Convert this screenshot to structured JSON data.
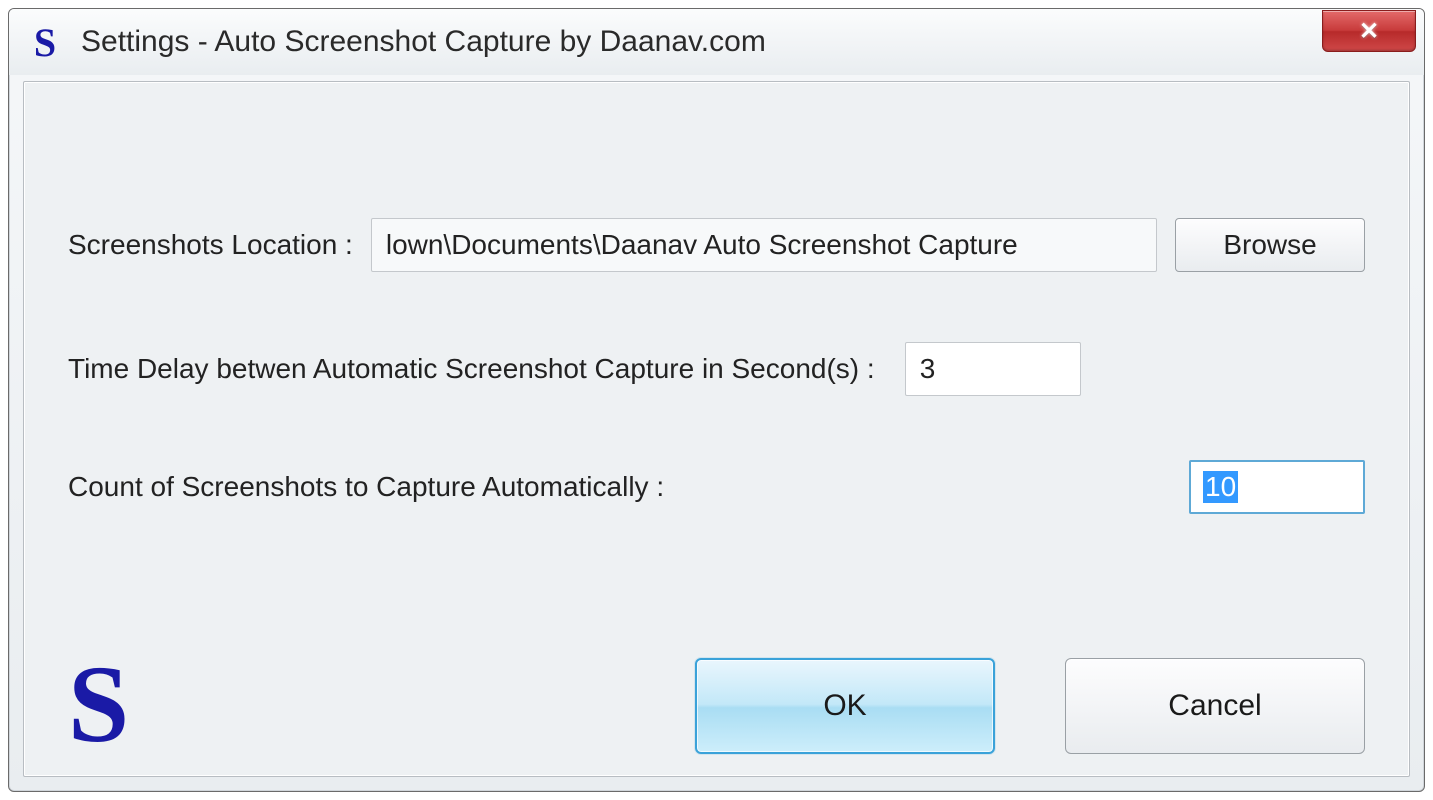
{
  "window": {
    "title": "Settings - Auto Screenshot Capture by Daanav.com",
    "app_icon_letter": "S",
    "close_glyph": "✕"
  },
  "form": {
    "location_label": "Screenshots Location :",
    "location_value": "lown\\Documents\\Daanav Auto Screenshot Capture",
    "browse_label": "Browse",
    "delay_label": "Time Delay betwen Automatic Screenshot Capture  in Second(s) :",
    "delay_value": "3",
    "count_label": "Count of Screenshots to Capture Automatically :",
    "count_value": "10"
  },
  "footer": {
    "logo_letter": "S",
    "ok_label": "OK",
    "cancel_label": "Cancel"
  }
}
